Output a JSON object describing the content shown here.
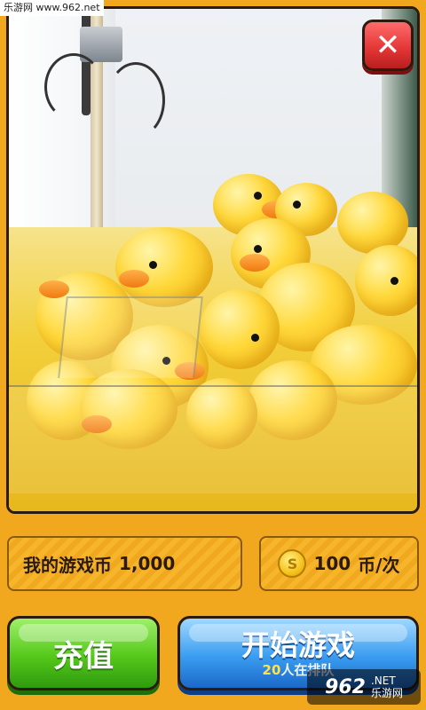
{
  "watermark": {
    "top_text": "乐游网 www.962.net",
    "logo_num": "962",
    "logo_net": ".NET",
    "logo_cn": "乐游网"
  },
  "camera": {
    "close_icon": "close-icon"
  },
  "stats": {
    "coins_label": "我的游戏币",
    "coins_value": "1,000",
    "coin_icon": "S",
    "cost_value": "100",
    "cost_unit": "币/次"
  },
  "buttons": {
    "recharge_label": "充值",
    "start_label": "开始游戏",
    "queue_count": "20",
    "queue_text": "人在排队"
  },
  "colors": {
    "background": "#f2a81e",
    "recharge": "#55c81a",
    "start": "#3a9df0",
    "close": "#e23434"
  }
}
